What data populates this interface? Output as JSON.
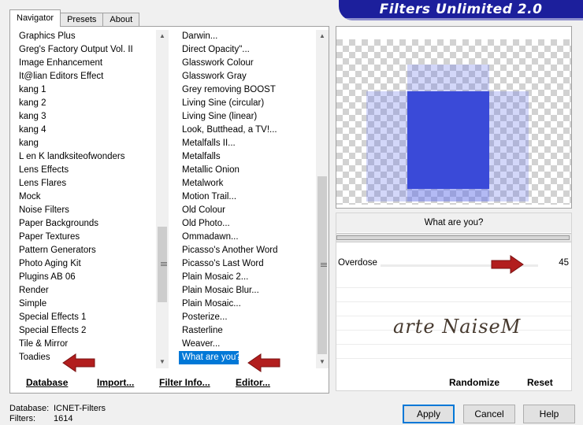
{
  "tabs": [
    "Navigator",
    "Presets",
    "About"
  ],
  "banner_title": "Filters Unlimited 2.0",
  "categories": [
    "Graphics Plus",
    "Greg's Factory Output Vol. II",
    "Image Enhancement",
    "It@lian Editors Effect",
    "kang 1",
    "kang 2",
    "kang 3",
    "kang 4",
    "kang",
    "L en K landksiteofwonders",
    "Lens Effects",
    "Lens Flares",
    "Mock",
    "Noise Filters",
    "Paper Backgrounds",
    "Paper Textures",
    "Pattern Generators",
    "Photo Aging Kit",
    "Plugins AB 06",
    "Render",
    "Simple",
    "Special Effects 1",
    "Special Effects 2",
    "Tile & Mirror",
    "Toadies"
  ],
  "filters": [
    "Darwin...",
    "Direct Opacity\"...",
    "Glasswork Colour",
    "Glasswork Gray",
    "Grey removing BOOST",
    "Living Sine (circular)",
    "Living Sine (linear)",
    "Look, Butthead, a TV!...",
    "Metalfalls II...",
    "Metalfalls",
    "Metallic Onion",
    "Metalwork",
    "Motion Trail...",
    "Old Colour",
    "Old Photo...",
    "Ommadawn...",
    "Picasso's Another Word",
    "Picasso's Last Word",
    "Plain Mosaic 2...",
    "Plain Mosaic Blur...",
    "Plain Mosaic...",
    "Posterize...",
    "Rasterline",
    "Weaver...",
    "What are you?"
  ],
  "selected_filter": "What are you?",
  "buttons": {
    "database": "Database",
    "import": "Import...",
    "filter_info": "Filter Info...",
    "editor": "Editor...",
    "randomize": "Randomize",
    "reset": "Reset",
    "apply": "Apply",
    "cancel": "Cancel",
    "help": "Help"
  },
  "filter_title": "What are you?",
  "parameter": {
    "name": "Overdose",
    "value": "45"
  },
  "watermark": "arte NaiseM",
  "status": {
    "database_label": "Database:",
    "database_value": "ICNET-Filters",
    "filters_label": "Filters:",
    "filters_value": "1614"
  },
  "colors": {
    "accent": "#0078d7",
    "banner": "#1c1f9c",
    "arrow": "#b21e1e",
    "preview_blue": "#3a4ad8"
  }
}
